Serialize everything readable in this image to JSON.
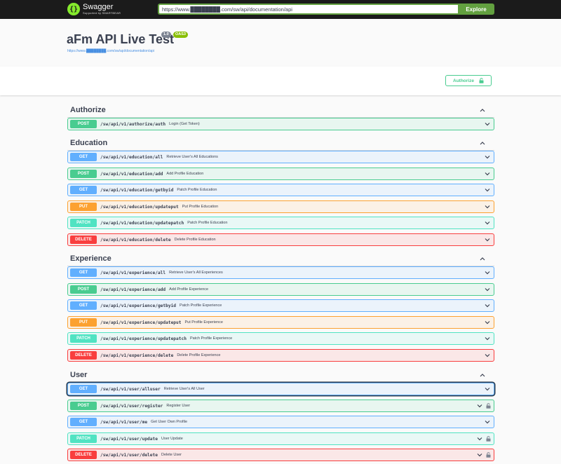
{
  "topbar": {
    "brand_name": "Swagger",
    "brand_sub": "Supported by SMARTBEAR",
    "url_value": "https://www.████████.com/sw/api/documentation/api",
    "explore_label": "Explore"
  },
  "info": {
    "title": "aFm API Live Test",
    "version": "1.0",
    "oas": "OAS3",
    "spec_url": "https://www.████████.com/sw/api/documentation/api"
  },
  "authorize": {
    "label": "Authorize"
  },
  "tags": [
    {
      "name": "Authorize",
      "operations": [
        {
          "method": "POST",
          "path": "/sw/api/v1/authorize/auth",
          "summary": "Login (Get Token)",
          "locked": false
        }
      ]
    },
    {
      "name": "Education",
      "operations": [
        {
          "method": "GET",
          "path": "/sw/api/v1/education/all",
          "summary": "Retrieve User's All Educations",
          "locked": false
        },
        {
          "method": "POST",
          "path": "/sw/api/v1/education/add",
          "summary": "Add Profile Education",
          "locked": false
        },
        {
          "method": "GET",
          "path": "/sw/api/v1/education/getbyid",
          "summary": "Patch Profile Education",
          "locked": false
        },
        {
          "method": "PUT",
          "path": "/sw/api/v1/education/updateput",
          "summary": "Put Profile Education",
          "locked": false
        },
        {
          "method": "PATCH",
          "path": "/sw/api/v1/education/updatepatch",
          "summary": "Patch Profile Education",
          "locked": false
        },
        {
          "method": "DELETE",
          "path": "/sw/api/v1/education/delete",
          "summary": "Delete Profile Education",
          "locked": false
        }
      ]
    },
    {
      "name": "Experience",
      "operations": [
        {
          "method": "GET",
          "path": "/sw/api/v1/experience/all",
          "summary": "Retrieve User's All Experiences",
          "locked": false
        },
        {
          "method": "POST",
          "path": "/sw/api/v1/experience/add",
          "summary": "Add Profile Experience",
          "locked": false
        },
        {
          "method": "GET",
          "path": "/sw/api/v1/experience/getbyid",
          "summary": "Patch Profile Experience",
          "locked": false
        },
        {
          "method": "PUT",
          "path": "/sw/api/v1/experience/updateput",
          "summary": "Put Profile Experience",
          "locked": false
        },
        {
          "method": "PATCH",
          "path": "/sw/api/v1/experience/updatepatch",
          "summary": "Patch Profile Experience",
          "locked": false
        },
        {
          "method": "DELETE",
          "path": "/sw/api/v1/experience/delete",
          "summary": "Delete Profile Experience",
          "locked": false
        }
      ]
    },
    {
      "name": "User",
      "operations": [
        {
          "method": "GET",
          "path": "/sw/api/v1/user/alluser",
          "summary": "Retrieve User's All User",
          "locked": false,
          "focused": true
        },
        {
          "method": "POST",
          "path": "/sw/api/v1/user/register",
          "summary": "Register User",
          "locked": true
        },
        {
          "method": "GET",
          "path": "/sw/api/v1/user/me",
          "summary": "Get User Own Profile",
          "locked": false
        },
        {
          "method": "PATCH",
          "path": "/sw/api/v1/user/update",
          "summary": "User Update",
          "locked": true
        },
        {
          "method": "DELETE",
          "path": "/sw/api/v1/user/delete",
          "summary": "Delete User",
          "locked": true
        }
      ]
    }
  ],
  "colors": {
    "post": "#49cc90",
    "get": "#61affe",
    "put": "#fca130",
    "patch": "#50e3c2",
    "delete": "#f93e3e",
    "brand": "#85ea2d",
    "explore": "#62a03f"
  },
  "icons": {
    "tag_toggle": "chevron-up-icon",
    "op_toggle": "chevron-down-icon",
    "lock": "lock-icon"
  }
}
